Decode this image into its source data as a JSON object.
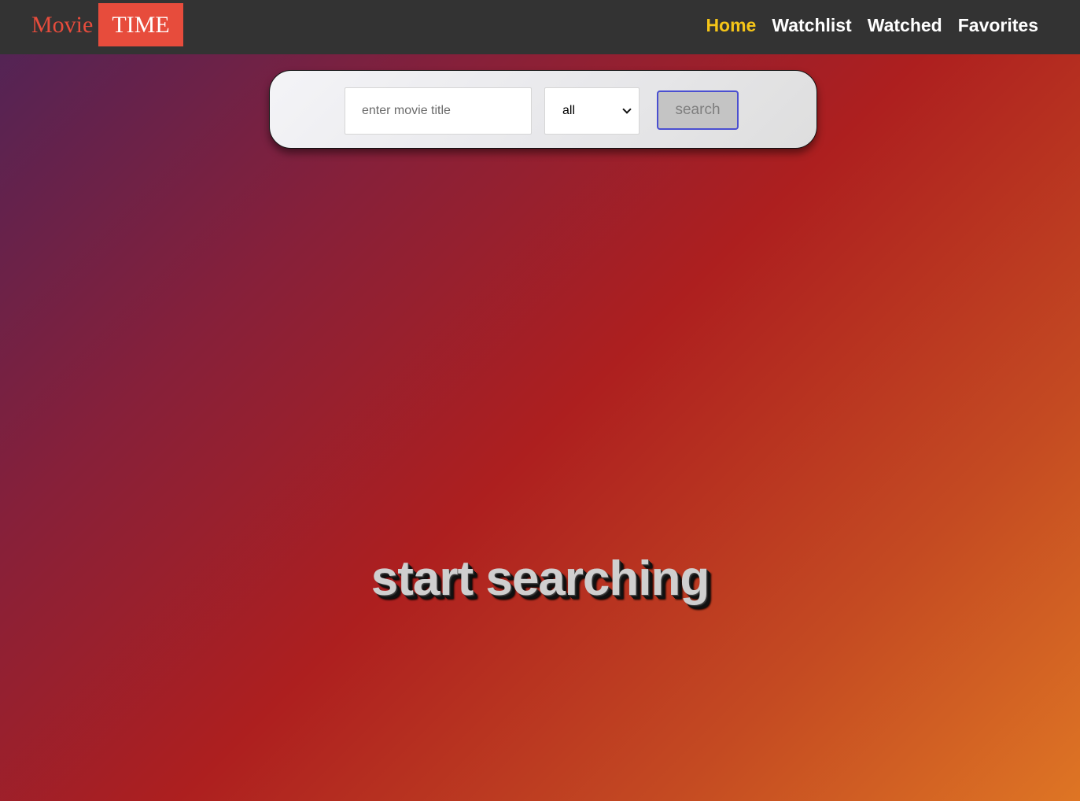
{
  "brand": {
    "part1": "Movie",
    "part2": "TIME",
    "accent_color": "#e74c3c"
  },
  "nav": {
    "items": [
      {
        "label": "Home",
        "active": true
      },
      {
        "label": "Watchlist",
        "active": false
      },
      {
        "label": "Watched",
        "active": false
      },
      {
        "label": "Favorites",
        "active": false
      }
    ],
    "active_color": "#f5c518",
    "background_color": "#333333"
  },
  "search": {
    "placeholder": "enter movie title",
    "value": "",
    "category_selected": "all",
    "button_label": "search"
  },
  "main": {
    "message": "start searching"
  }
}
